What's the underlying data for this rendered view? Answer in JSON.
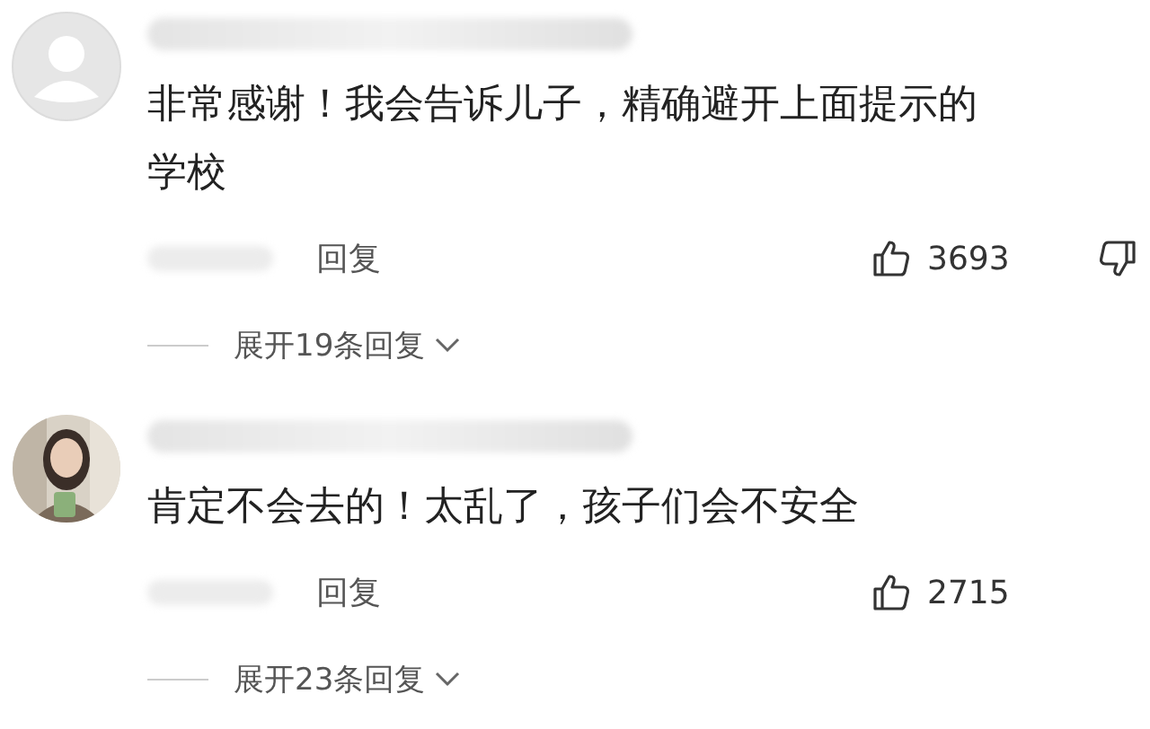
{
  "comments": [
    {
      "avatar": {
        "kind": "default"
      },
      "text": "非常感谢！我会告诉儿子，精确避开上面提示的学校",
      "reply_label": "回复",
      "likes": "3693",
      "dislike_button": true,
      "expand": "展开19条回复"
    },
    {
      "text": "肯定不会去的！太乱了，孩子们会不安全",
      "reply_label": "回复",
      "likes": "2715",
      "dislike_button": false,
      "expand": "展开23条回复"
    }
  ]
}
